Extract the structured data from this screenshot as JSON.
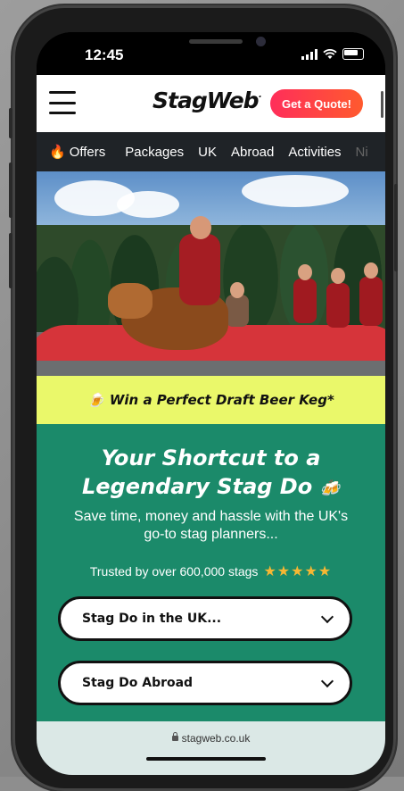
{
  "status_bar": {
    "time": "12:45"
  },
  "header": {
    "logo": "StagWeb",
    "logo_mark": "·",
    "quote_button": "Get a Quote!"
  },
  "nav": {
    "items": [
      {
        "icon": "🔥",
        "label": "Offers"
      },
      {
        "label": "Packages"
      },
      {
        "label": "UK"
      },
      {
        "label": "Abroad"
      },
      {
        "label": "Activities"
      },
      {
        "label": "Ni"
      }
    ]
  },
  "promo": {
    "icon": "🍺",
    "text": "Win a Perfect Draft Beer Keg*"
  },
  "main": {
    "title_line1": "Your Shortcut to a",
    "title_line2": "Legendary Stag Do",
    "title_icon": "🍻",
    "subtitle": "Save time, money and hassle with the UK's go-to stag planners...",
    "trust_text": "Trusted by over 600,000 stags",
    "stars": "★★★★★",
    "select_uk": "Stag Do in the UK...",
    "select_abroad": "Stag Do Abroad"
  },
  "browser": {
    "url": "stagweb.co.uk"
  },
  "colors": {
    "brand_green": "#1b8a6a",
    "promo_yellow": "#eaf86a",
    "quote_gradient_start": "#ff2e5a",
    "quote_gradient_end": "#ff5a2e",
    "nav_bg": "#1f2327"
  }
}
